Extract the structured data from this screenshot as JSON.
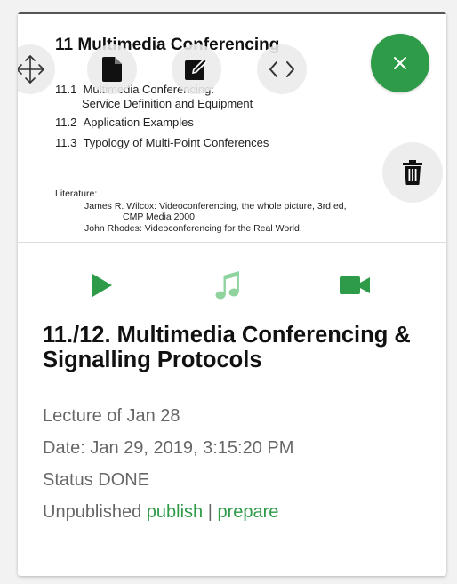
{
  "thumbnail": {
    "heading": "11  Multimedia Conferencing",
    "items": [
      {
        "num": "11.1",
        "text": "Multimedia Conferencing:"
      },
      {
        "num": "",
        "text": "Service Definition and Equipment"
      },
      {
        "num": "11.2",
        "text": "Application Examples"
      },
      {
        "num": "11.3",
        "text": "Typology of Multi-Point Conferences"
      }
    ],
    "literature_label": "Literature:",
    "literature": [
      "James R. Wilcox: Videoconferencing, the whole picture, 3rd ed,",
      "CMP Media 2000",
      "John Rhodes: Videoconferencing for the Real World,"
    ]
  },
  "toolbar": {
    "move_icon": "move-arrows-icon",
    "document_icon": "document-icon",
    "edit_icon": "edit-icon",
    "code_icon": "code-brackets-icon",
    "close_icon": "close-x-icon",
    "delete_icon": "trash-icon"
  },
  "colors": {
    "accent": "#2e9b49",
    "accent_light": "#8fd49f",
    "text_primary": "#111111",
    "text_secondary": "#666666"
  },
  "media": {
    "play_icon": "play-icon",
    "audio_icon": "music-note-icon",
    "video_icon": "video-camera-icon"
  },
  "lecture": {
    "title": "11./12. Multimedia Conferencing & Signalling Protocols",
    "subtitle": "Lecture of Jan 28",
    "date": "Date: Jan 29, 2019, 3:15:20 PM",
    "status": "Status DONE",
    "publish_state": "Unpublished",
    "publish_link": "publish",
    "separator": "|",
    "prepare_link": "prepare"
  }
}
